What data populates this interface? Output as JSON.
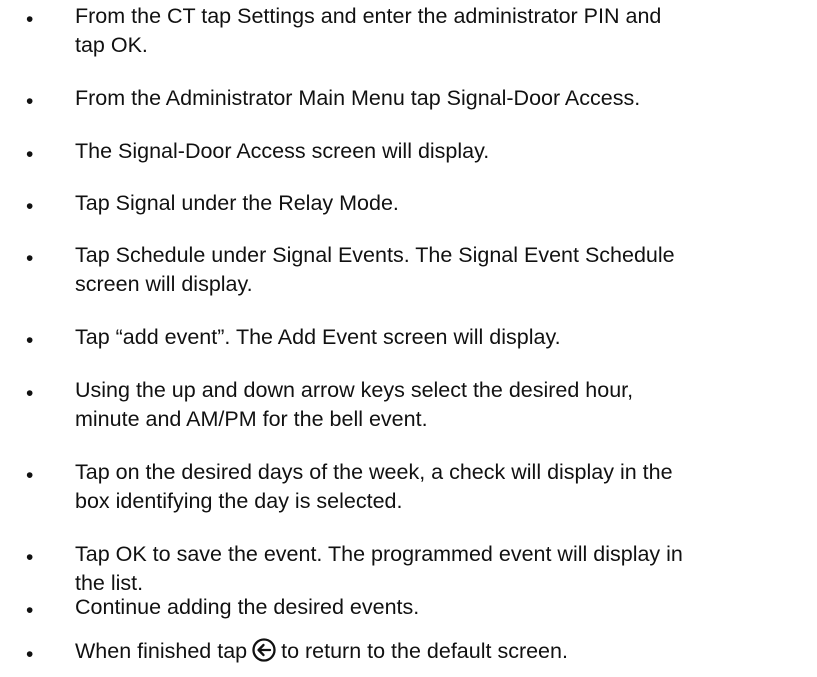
{
  "steps": [
    {
      "text": "From the CT tap Settings and enter the administrator PIN and\ntap OK."
    },
    {
      "text": "From the Administrator Main Menu tap Signal-Door Access."
    },
    {
      "text": "The Signal-Door Access screen will display."
    },
    {
      "text": "Tap Signal under the Relay Mode."
    },
    {
      "text": "Tap Schedule under Signal Events. The Signal Event Schedule\nscreen will display."
    },
    {
      "text": "Tap “add event”. The Add Event screen will display."
    },
    {
      "text": "Using the up and down arrow keys select the desired hour,\nminute and AM/PM for the bell event."
    },
    {
      "text": "Tap on the desired days of the week, a check will display in the\nbox identifying the day is selected."
    },
    {
      "text": "Tap OK to save the event. The programmed event will display in\nthe list."
    },
    {
      "text": "Continue adding the desired events."
    },
    {
      "text_before": "When finished tap",
      "text_after": "to return to the default screen.",
      "icon": "back-arrow-icon"
    }
  ],
  "bullet_glyph": "•"
}
